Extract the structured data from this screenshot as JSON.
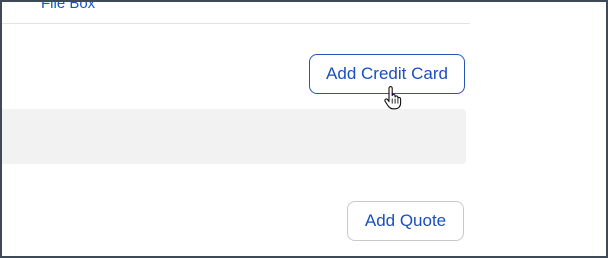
{
  "header": {
    "file_box_link": "File Box"
  },
  "actions": {
    "add_credit_card_label": "Add Credit Card",
    "add_quote_label": "Add Quote"
  },
  "colors": {
    "link_blue": "#1a4fbf",
    "panel_gray": "#f2f2f2",
    "button_border_active": "#2756b8",
    "button_border_default": "#c9c9c9"
  },
  "icons": {
    "cursor": "hand-pointer-icon"
  }
}
